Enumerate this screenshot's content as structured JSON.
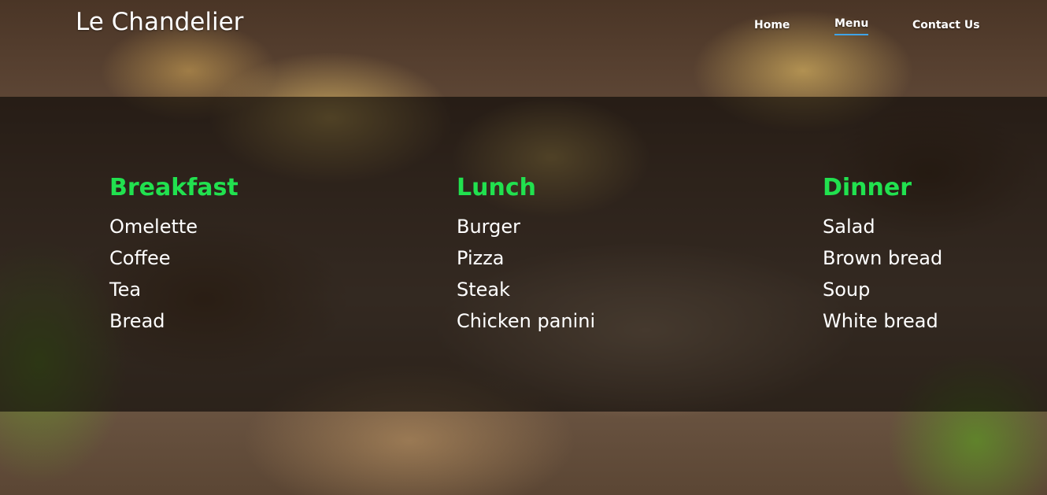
{
  "brand": "Le Chandelier",
  "nav": {
    "home": "Home",
    "menu": "Menu",
    "contact": "Contact Us",
    "active": "Menu"
  },
  "colors": {
    "accent_green": "#21e14f",
    "nav_underline": "#3fa4e8"
  },
  "menu": {
    "breakfast": {
      "title": "Breakfast",
      "items": [
        "Omelette",
        "Coffee",
        "Tea",
        "Bread"
      ]
    },
    "lunch": {
      "title": "Lunch",
      "items": [
        "Burger",
        "Pizza",
        "Steak",
        "Chicken panini"
      ]
    },
    "dinner": {
      "title": "Dinner",
      "items": [
        "Salad",
        "Brown bread",
        "Soup",
        "White bread"
      ]
    }
  }
}
